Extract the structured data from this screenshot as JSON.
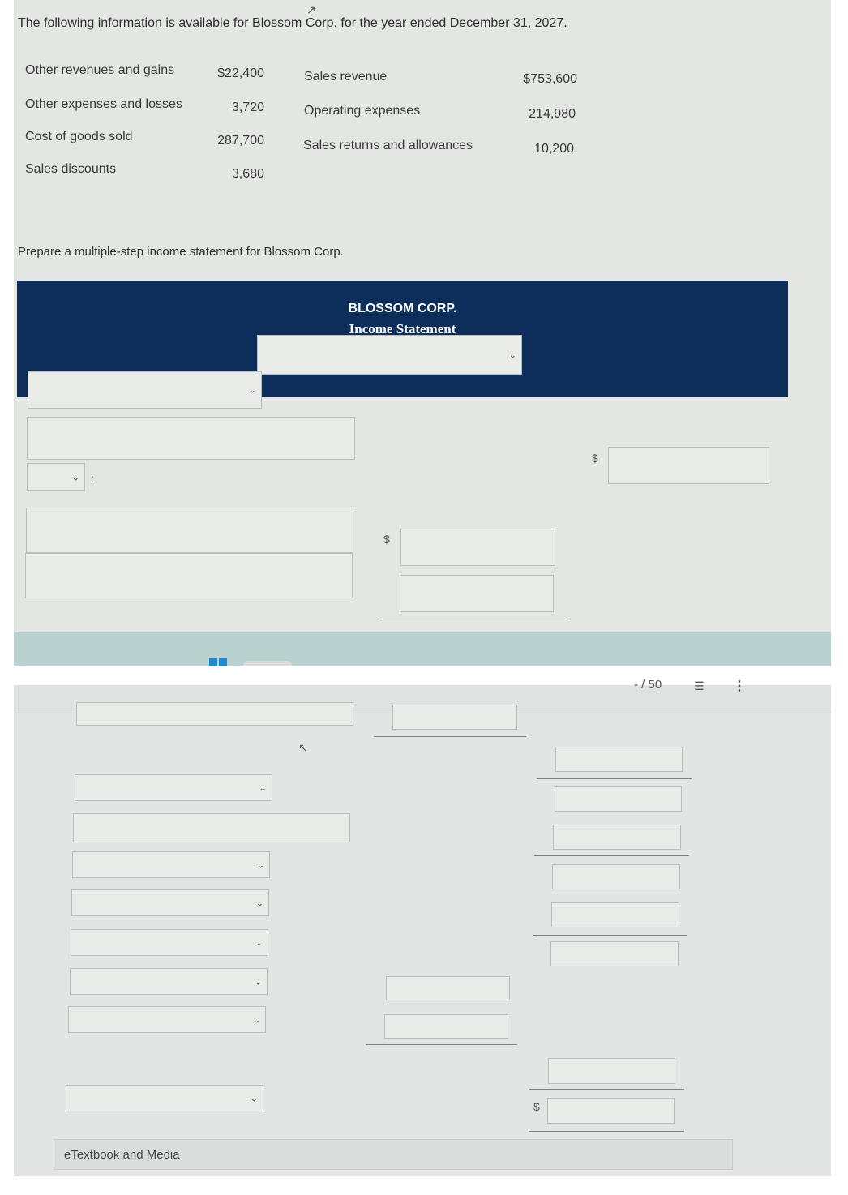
{
  "question": {
    "intro": "The following information is available for Blossom Corp. for the year ended December 31, 2027.",
    "items_left": [
      {
        "label": "Other revenues and gains",
        "value": "$22,400"
      },
      {
        "label": "Other expenses and losses",
        "value": "3,720"
      },
      {
        "label": "Cost of goods sold",
        "value": "287,700"
      },
      {
        "label": "Sales discounts",
        "value": "3,680"
      }
    ],
    "items_right": [
      {
        "label": "Sales revenue",
        "value": "$753,600"
      },
      {
        "label": "Operating expenses",
        "value": "214,980"
      },
      {
        "label": "Sales returns and allowances",
        "value": "10,200"
      }
    ],
    "prompt": "Prepare a multiple-step income statement for Blossom Corp."
  },
  "statement": {
    "company": "BLOSSOM CORP.",
    "title": "Income Statement",
    "period_select_value": "",
    "currency_symbol": "$",
    "colon": ":"
  },
  "viewer": {
    "page_indicator": "- / 50",
    "list_icon": "list-icon",
    "more_icon": "more-vertical-icon"
  },
  "footer": {
    "etextbook_label": "eTextbook and Media"
  }
}
